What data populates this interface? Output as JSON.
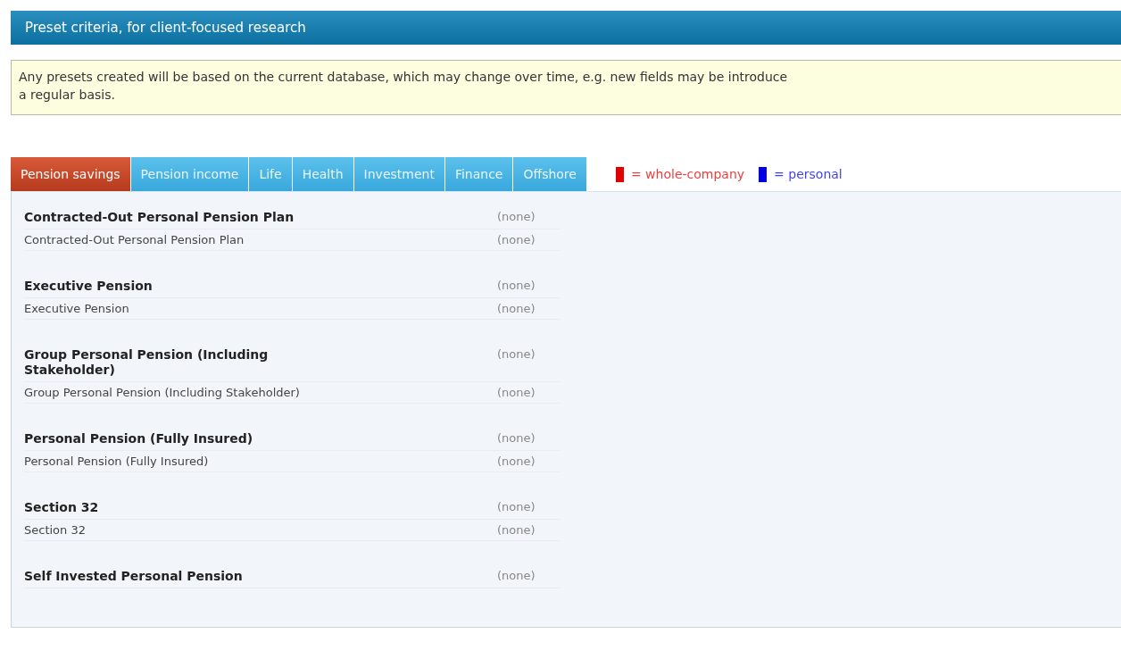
{
  "header": {
    "title": "Preset criteria, for client-focused research"
  },
  "notice": {
    "lines": [
      "Any presets created will be based on the current database, which may change over time, e.g. new fields may be introduce",
      "a regular basis."
    ]
  },
  "tabs": [
    {
      "label": "Pension savings",
      "selected": true
    },
    {
      "label": "Pension income",
      "selected": false
    },
    {
      "label": "Life",
      "selected": false
    },
    {
      "label": "Health",
      "selected": false
    },
    {
      "label": "Investment",
      "selected": false
    },
    {
      "label": "Finance",
      "selected": false
    },
    {
      "label": "Offshore",
      "selected": false
    }
  ],
  "legend": [
    {
      "label": "= whole-company",
      "color": "#e00000"
    },
    {
      "label": "= personal",
      "color": "#0000e0"
    }
  ],
  "groups": [
    {
      "title": "Contracted-Out Personal Pension Plan",
      "value": "(none)",
      "items": [
        {
          "label": "Contracted-Out Personal Pension Plan",
          "value": "(none)"
        }
      ]
    },
    {
      "title": "Executive Pension",
      "value": "(none)",
      "items": [
        {
          "label": "Executive Pension",
          "value": "(none)"
        }
      ]
    },
    {
      "title": "Group Personal Pension (Including Stakeholder)",
      "value": "(none)",
      "items": [
        {
          "label": "Group Personal Pension (Including Stakeholder)",
          "value": "(none)"
        }
      ]
    },
    {
      "title": "Personal Pension (Fully Insured)",
      "value": "(none)",
      "items": [
        {
          "label": "Personal Pension (Fully Insured)",
          "value": "(none)"
        }
      ]
    },
    {
      "title": "Section 32",
      "value": "(none)",
      "items": [
        {
          "label": "Section 32",
          "value": "(none)"
        }
      ]
    },
    {
      "title": "Self Invested Personal Pension",
      "value": "(none)"
    }
  ]
}
